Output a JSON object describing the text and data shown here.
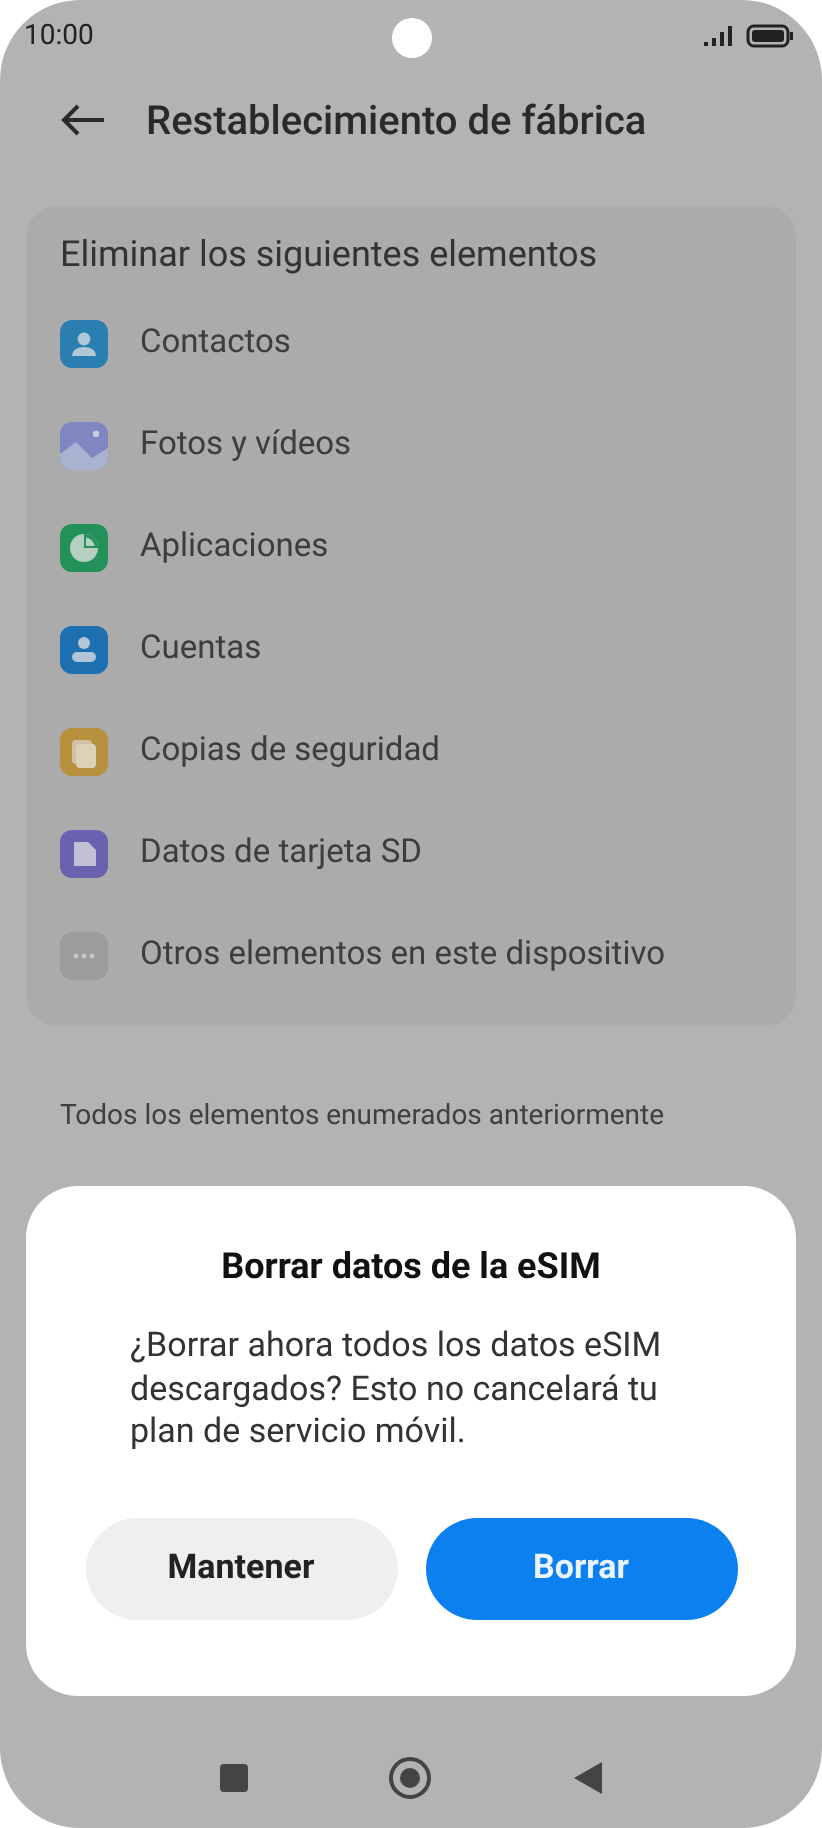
{
  "status_bar": {
    "time": "10:00"
  },
  "header": {
    "title": "Restablecimiento de fábrica"
  },
  "card": {
    "title": "Eliminar los siguientes elementos",
    "items": [
      {
        "kind": "contacts",
        "label": "Contactos"
      },
      {
        "kind": "photos",
        "label": "Fotos y vídeos"
      },
      {
        "kind": "apps",
        "label": "Aplicaciones"
      },
      {
        "kind": "accounts",
        "label": "Cuentas"
      },
      {
        "kind": "backup",
        "label": "Copias de seguridad"
      },
      {
        "kind": "sdcard",
        "label": "Datos de tarjeta SD"
      },
      {
        "kind": "other",
        "label": "Otros elementos en este dispositivo"
      }
    ]
  },
  "note": "Todos los elementos enumerados anteriormente",
  "dialog": {
    "title": "Borrar datos de la eSIM",
    "message": "¿Borrar ahora todos los datos eSIM descargados? Esto no cancelará tu plan de servicio móvil.",
    "buttons": [
      {
        "label": "Mantener",
        "kind": "secondary"
      },
      {
        "label": "Borrar",
        "kind": "primary"
      }
    ]
  }
}
